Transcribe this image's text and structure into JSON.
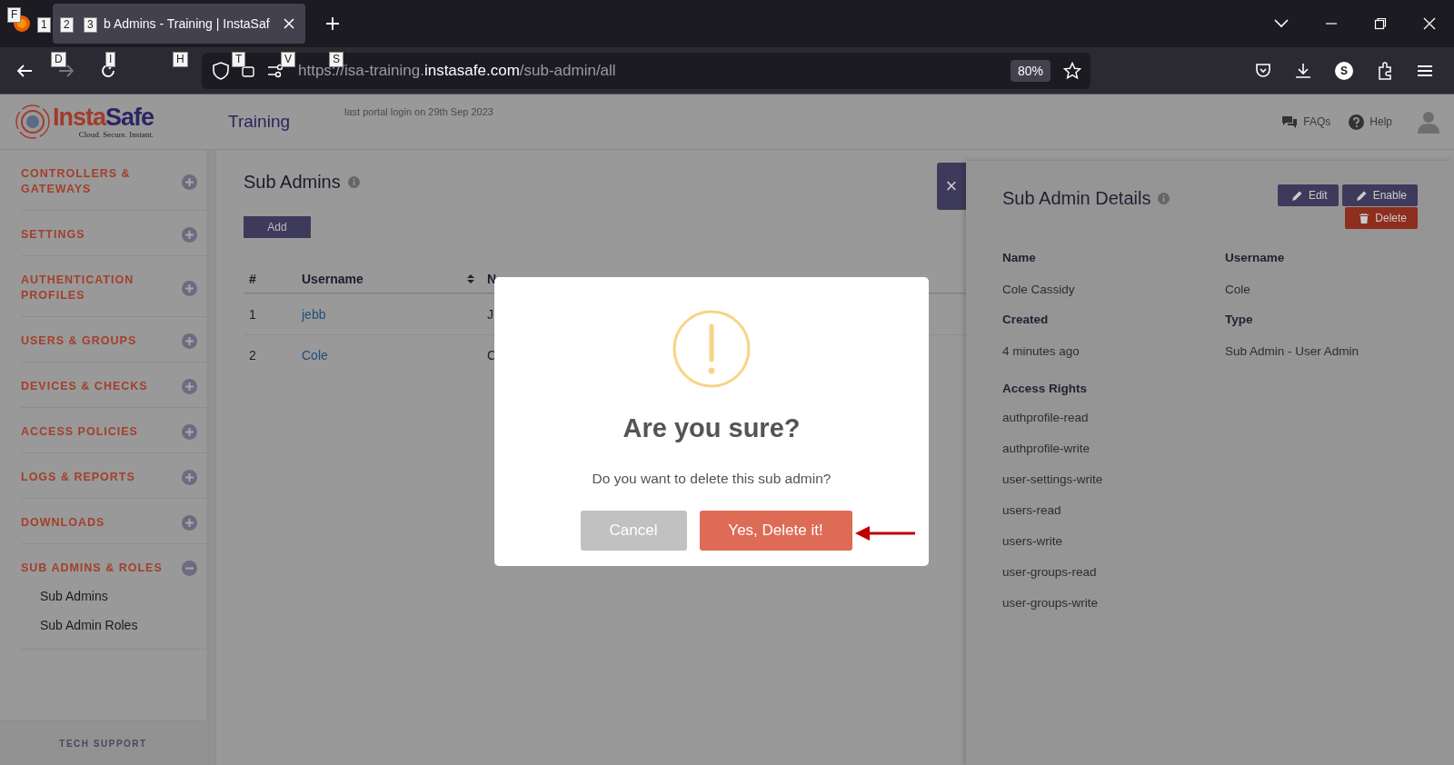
{
  "browser": {
    "tabs": [
      {
        "title": "b Admins - Training | InstaSaf",
        "selected": true
      }
    ],
    "hints": {
      "tab_bar": [
        "F",
        "1",
        "2",
        "3"
      ],
      "toolbar": [
        "D",
        "I",
        "H",
        "T",
        "V",
        "S"
      ]
    },
    "url": {
      "prefix": "https://isa-training.",
      "domain": "instasafe.com",
      "path": "/sub-admin/all"
    },
    "zoom": "80%",
    "profile_initial": "S"
  },
  "header": {
    "logo": {
      "first": "Insta",
      "second": "Safe",
      "tagline": "Cloud. Secure. Instant."
    },
    "title": "Training",
    "last_login": "last portal login on 29th Sep 2023",
    "links": [
      {
        "kind": "faq",
        "label": "FAQs"
      },
      {
        "kind": "help",
        "label": "Help"
      }
    ]
  },
  "sidebar": {
    "items": [
      {
        "label": "CONTROLLERS & GATEWAYS",
        "expanded": false
      },
      {
        "label": "SETTINGS",
        "expanded": false
      },
      {
        "label": "AUTHENTICATION PROFILES",
        "expanded": false
      },
      {
        "label": "USERS & GROUPS",
        "expanded": false
      },
      {
        "label": "DEVICES & CHECKS",
        "expanded": false
      },
      {
        "label": "ACCESS POLICIES",
        "expanded": false
      },
      {
        "label": "LOGS & REPORTS",
        "expanded": false
      },
      {
        "label": "DOWNLOADS",
        "expanded": false
      },
      {
        "label": "SUB ADMINS & ROLES",
        "expanded": true,
        "children": [
          {
            "label": "Sub Admins"
          },
          {
            "label": "Sub Admin Roles"
          }
        ]
      }
    ],
    "footer": "TECH SUPPORT"
  },
  "main": {
    "title": "Sub Admins",
    "add_button": "Add",
    "table": {
      "columns": [
        "#",
        "Username",
        "N"
      ],
      "rows": [
        {
          "number": "1",
          "username": "jebb",
          "column_3": "J"
        },
        {
          "number": "2",
          "username": "Cole",
          "column_3": "C"
        }
      ]
    }
  },
  "panel": {
    "close": "×",
    "title": "Sub Admin Details",
    "buttons": [
      {
        "kind": "edit",
        "label": "Edit"
      },
      {
        "kind": "edit",
        "label": "Enable"
      },
      {
        "kind": "delete",
        "label": "Delete"
      }
    ],
    "fields": [
      {
        "label": "Name",
        "value": "Cole Cassidy"
      },
      {
        "label": "Username",
        "value": "Cole"
      },
      {
        "label": "Created",
        "value": "4 minutes ago"
      },
      {
        "label": "Type",
        "value": "Sub Admin - User Admin"
      }
    ],
    "access_rights_label": "Access Rights",
    "access_rights": [
      "authprofile-read",
      "authprofile-write",
      "user-settings-write",
      "users-read",
      "users-write",
      "user-groups-read",
      "user-groups-write"
    ]
  },
  "dialog": {
    "title": "Are you sure?",
    "message": "Do you want to delete this sub admin?",
    "buttons": [
      {
        "kind": "cancel",
        "label": "Cancel"
      },
      {
        "kind": "confirm",
        "label": "Yes, Delete it!"
      }
    ]
  }
}
